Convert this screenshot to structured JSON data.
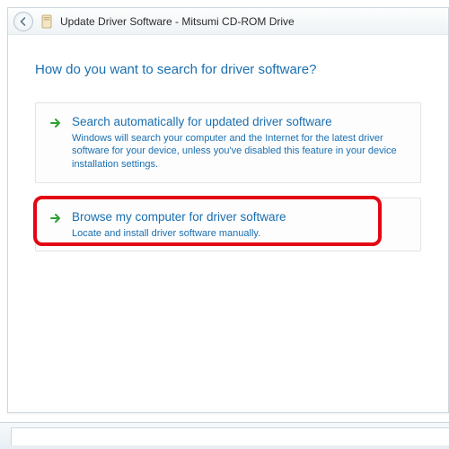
{
  "titlebar": {
    "title": "Update Driver Software - Mitsumi CD-ROM Drive"
  },
  "heading": "How do you want to search for driver software?",
  "options": {
    "auto": {
      "title": "Search automatically for updated driver software",
      "desc": "Windows will search your computer and the Internet for the latest driver software for your device, unless you've disabled this feature in your device installation settings."
    },
    "browse": {
      "title": "Browse my computer for driver software",
      "desc": "Locate and install driver software manually."
    }
  }
}
